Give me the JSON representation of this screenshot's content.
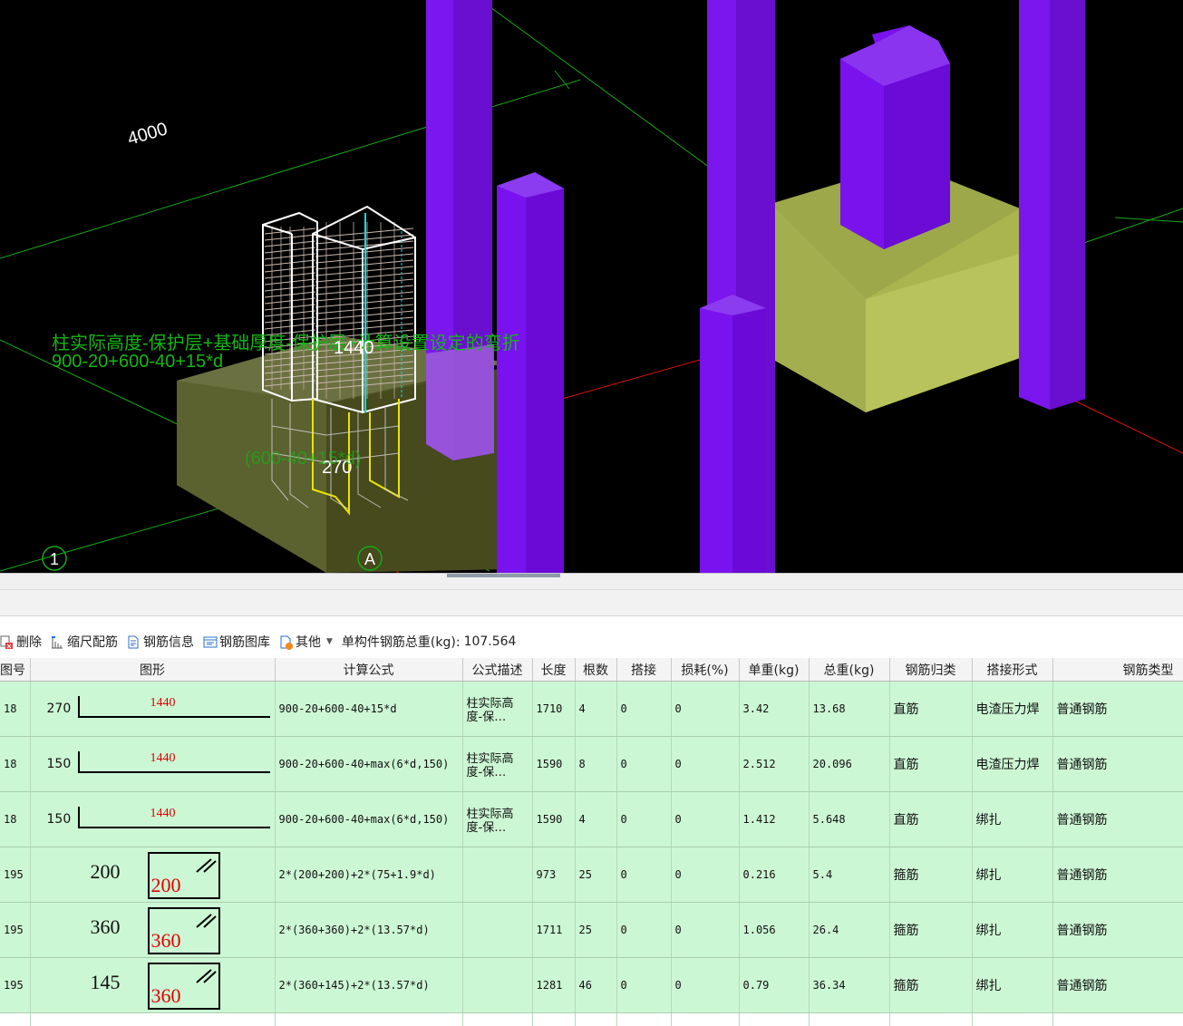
{
  "viewport": {
    "dimension_label": "4000",
    "axis_labels": [
      "1",
      "A"
    ],
    "formula_text": "柱实际高度-保护层+基础厚度-保护层+计算设置设定的弯折",
    "formula_expr": "900-20+600-40+15*d",
    "rebar_label_1": "1440",
    "rebar_label_2": "270",
    "annotation_3": "(600-40+15*d)",
    "colors": {
      "column": "#7700ee",
      "footing": "#b9c45a",
      "grid_line": "#17a817",
      "axis_red": "#e01010"
    }
  },
  "toolbar": {
    "items": [
      {
        "label": "删除",
        "icon": "delete-icon"
      },
      {
        "label": "缩尺配筋",
        "icon": "scale-rebar-icon"
      },
      {
        "label": "钢筋信息",
        "icon": "document-icon"
      },
      {
        "label": "钢筋图库",
        "icon": "gallery-icon"
      },
      {
        "label": "其他",
        "icon": "other-icon"
      }
    ],
    "total_label": "单构件钢筋总重(kg):",
    "total_value": "107.564"
  },
  "grid": {
    "headers": [
      "图号",
      "图形",
      "计算公式",
      "公式描述",
      "长度",
      "根数",
      "搭接",
      "损耗(%)",
      "单重(kg)",
      "总重(kg)",
      "钢筋归类",
      "搭接形式",
      "钢筋类型"
    ],
    "rows": [
      {
        "fig": "18",
        "shape_type": "straight",
        "shape_left": "270",
        "shape_len": "1440",
        "formula": "900-20+600-40+15*d",
        "desc": "柱实际高度-保…",
        "length": "1710",
        "count": "4",
        "lap": "0",
        "loss": "0",
        "unit_weight": "3.42",
        "total_weight": "13.68",
        "category": "直筋",
        "lap_type": "电渣压力焊",
        "rebar_type": "普通钢筋"
      },
      {
        "fig": "18",
        "shape_type": "straight",
        "shape_left": "150",
        "shape_len": "1440",
        "formula": "900-20+600-40+max(6*d,150)",
        "desc": "柱实际高度-保…",
        "length": "1590",
        "count": "8",
        "lap": "0",
        "loss": "0",
        "unit_weight": "2.512",
        "total_weight": "20.096",
        "category": "直筋",
        "lap_type": "电渣压力焊",
        "rebar_type": "普通钢筋"
      },
      {
        "fig": "18",
        "shape_type": "straight",
        "shape_left": "150",
        "shape_len": "1440",
        "formula": "900-20+600-40+max(6*d,150)",
        "desc": "柱实际高度-保…",
        "length": "1590",
        "count": "4",
        "lap": "0",
        "loss": "0",
        "unit_weight": "1.412",
        "total_weight": "5.648",
        "category": "直筋",
        "lap_type": "绑扎",
        "rebar_type": "普通钢筋"
      },
      {
        "fig": "195",
        "shape_type": "stirrup",
        "shape_left": "200",
        "shape_len": "200",
        "formula": "2*(200+200)+2*(75+1.9*d)",
        "desc": "",
        "length": "973",
        "count": "25",
        "lap": "0",
        "loss": "0",
        "unit_weight": "0.216",
        "total_weight": "5.4",
        "category": "箍筋",
        "lap_type": "绑扎",
        "rebar_type": "普通钢筋"
      },
      {
        "fig": "195",
        "shape_type": "stirrup",
        "shape_left": "360",
        "shape_len": "360",
        "formula": "2*(360+360)+2*(13.57*d)",
        "desc": "",
        "length": "1711",
        "count": "25",
        "lap": "0",
        "loss": "0",
        "unit_weight": "1.056",
        "total_weight": "26.4",
        "category": "箍筋",
        "lap_type": "绑扎",
        "rebar_type": "普通钢筋"
      },
      {
        "fig": "195",
        "shape_type": "stirrup",
        "shape_left": "145",
        "shape_len": "360",
        "formula": "2*(360+145)+2*(13.57*d)",
        "desc": "",
        "length": "1281",
        "count": "46",
        "lap": "0",
        "loss": "0",
        "unit_weight": "0.79",
        "total_weight": "36.34",
        "category": "箍筋",
        "lap_type": "绑扎",
        "rebar_type": "普通钢筋"
      }
    ]
  }
}
